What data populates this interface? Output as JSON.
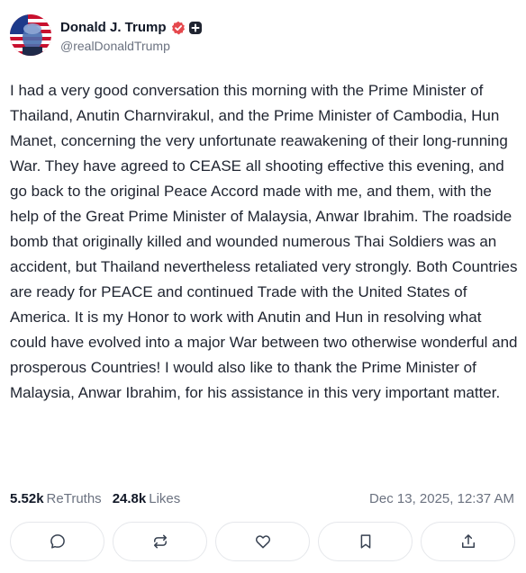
{
  "author": {
    "display_name": "Donald J. Trump",
    "handle": "@realDonaldTrump",
    "verified_color": "#e5484d"
  },
  "post": {
    "text": "I had a very good conversation this morning with the Prime Minister of Thailand, Anutin Charnvirakul, and the Prime Minister of Cambodia, Hun Manet, concerning the very unfortunate reawakening of their long-running War. They have agreed to CEASE all shooting effective this evening, and go back to the original Peace Accord made with me, and them, with the help of the Great Prime Minister of Malaysia, Anwar Ibrahim. The roadside bomb that originally killed and wounded numerous Thai Soldiers was an accident, but Thailand nevertheless retaliated very strongly. Both Countries are ready for PEACE and continued Trade with the United States of America. It is my Honor to work with Anutin and Hun in resolving what could have evolved into a major War between two otherwise wonderful and prosperous Countries! I would also like to thank the Prime Minister of Malaysia, Anwar Ibrahim, for his assistance in this very important matter."
  },
  "stats": {
    "retruths_count": "5.52k",
    "retruths_label": "ReTruths",
    "likes_count": "24.8k",
    "likes_label": "Likes",
    "timestamp": "Dec 13, 2025, 12:37 AM"
  },
  "actions": [
    {
      "icon": "reply-icon"
    },
    {
      "icon": "retruth-icon"
    },
    {
      "icon": "like-icon"
    },
    {
      "icon": "bookmark-icon"
    },
    {
      "icon": "share-icon"
    }
  ]
}
